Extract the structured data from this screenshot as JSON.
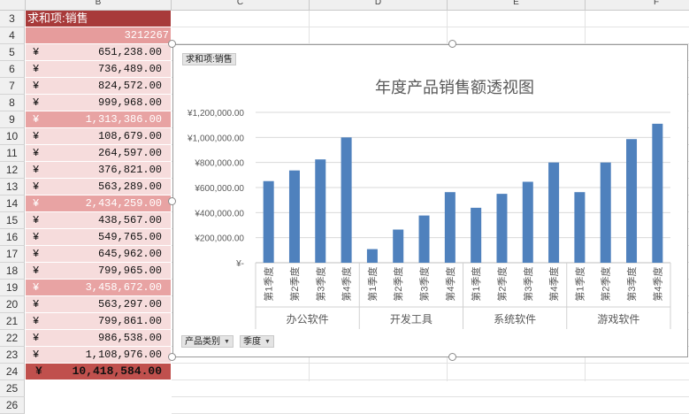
{
  "columns": [
    "B",
    "C",
    "D",
    "E",
    "F"
  ],
  "rows": [
    {
      "num": "3",
      "type": "header",
      "text": "求和项:销售"
    },
    {
      "num": "4",
      "type": "grand",
      "amount": "3212267"
    },
    {
      "num": "5",
      "type": "item",
      "yen": "¥",
      "amount": "651,238.00"
    },
    {
      "num": "6",
      "type": "item",
      "yen": "¥",
      "amount": "736,489.00"
    },
    {
      "num": "7",
      "type": "item",
      "yen": "¥",
      "amount": "824,572.00"
    },
    {
      "num": "8",
      "type": "item",
      "yen": "¥",
      "amount": "999,968.00"
    },
    {
      "num": "9",
      "type": "subtotal",
      "yen": "¥",
      "amount": "1,313,386.00"
    },
    {
      "num": "10",
      "type": "item",
      "yen": "¥",
      "amount": "108,679.00"
    },
    {
      "num": "11",
      "type": "item",
      "yen": "¥",
      "amount": "264,597.00"
    },
    {
      "num": "12",
      "type": "item",
      "yen": "¥",
      "amount": "376,821.00"
    },
    {
      "num": "13",
      "type": "item",
      "yen": "¥",
      "amount": "563,289.00"
    },
    {
      "num": "14",
      "type": "subtotal",
      "yen": "¥",
      "amount": "2,434,259.00"
    },
    {
      "num": "15",
      "type": "item",
      "yen": "¥",
      "amount": "438,567.00"
    },
    {
      "num": "16",
      "type": "item",
      "yen": "¥",
      "amount": "549,765.00"
    },
    {
      "num": "17",
      "type": "item",
      "yen": "¥",
      "amount": "645,962.00"
    },
    {
      "num": "18",
      "type": "item",
      "yen": "¥",
      "amount": "799,965.00"
    },
    {
      "num": "19",
      "type": "subtotal",
      "yen": "¥",
      "amount": "3,458,672.00"
    },
    {
      "num": "20",
      "type": "item",
      "yen": "¥",
      "amount": "563,297.00"
    },
    {
      "num": "21",
      "type": "item",
      "yen": "¥",
      "amount": "799,861.00"
    },
    {
      "num": "22",
      "type": "item",
      "yen": "¥",
      "amount": "986,538.00"
    },
    {
      "num": "23",
      "type": "item",
      "yen": "¥",
      "amount": "1,108,976.00"
    },
    {
      "num": "24",
      "type": "total",
      "yen": "¥",
      "amount": "10,418,584.00"
    },
    {
      "num": "25",
      "type": "blank"
    },
    {
      "num": "26",
      "type": "blank"
    }
  ],
  "colors": {
    "header_bg": "#a83a3a",
    "grand_bg": "#e69c9c",
    "item_bg": "#f6dcdc",
    "subtotal_bg": "#e8a3a3",
    "subtotal_text": "#ffffff",
    "total_bg": "#c0504d",
    "bar": "#4f81bd",
    "handle_border": "#8a8a8a"
  },
  "chart_fields": {
    "value_field": "求和项:销售",
    "category_field": "产品类别",
    "series_field": "季度",
    "dropdown_icon": "triangle-down-icon"
  },
  "chart_data": {
    "type": "bar",
    "title": "年度产品销售额透视图",
    "groups": [
      "办公软件",
      "开发工具",
      "系统软件",
      "游戏软件"
    ],
    "categories": [
      "第1季度",
      "第2季度",
      "第3季度",
      "第4季度"
    ],
    "values": [
      [
        651238,
        736489,
        824572,
        999968
      ],
      [
        108679,
        264597,
        376821,
        563289
      ],
      [
        438567,
        549765,
        645962,
        799965
      ],
      [
        563297,
        799861,
        986538,
        1108976
      ]
    ],
    "ylim": [
      0,
      1200000
    ],
    "yticks": [
      0,
      200000,
      400000,
      600000,
      800000,
      1000000,
      1200000
    ],
    "ytick_labels": [
      "¥-",
      "¥200,000.00",
      "¥400,000.00",
      "¥600,000.00",
      "¥800,000.00",
      "¥1,000,000.00",
      "¥1,200,000.00"
    ],
    "grid": true,
    "legend": "none"
  }
}
